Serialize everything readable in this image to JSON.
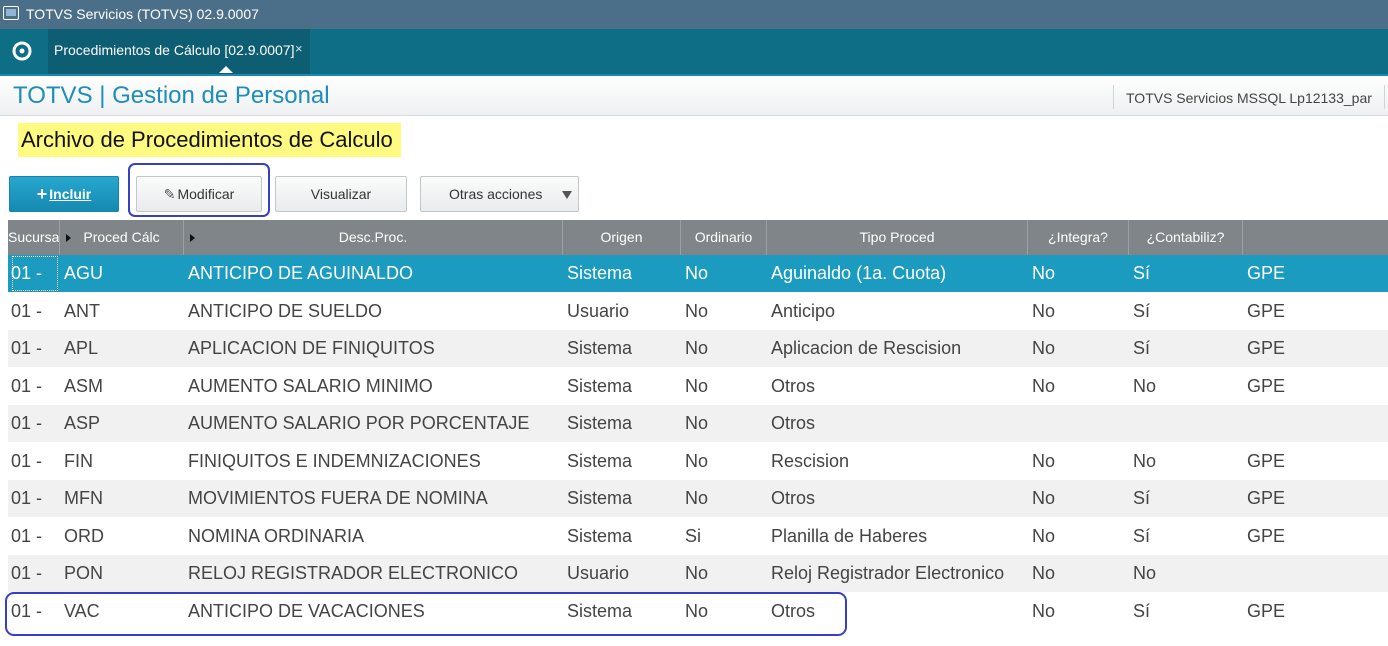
{
  "window": {
    "title": "TOTVS Servicios (TOTVS) 02.9.0007"
  },
  "tabs": [
    {
      "label": "Procedimientos de Cálculo [02.9.0007]",
      "close": "×",
      "active": true
    }
  ],
  "header": {
    "app_title": "TOTVS | Gestion de Personal",
    "environment": "TOTVS Servicios MSSQL Lp12133_par"
  },
  "page": {
    "title": "Archivo de Procedimientos de Calculo"
  },
  "toolbar": {
    "include_label": "Incluir",
    "modify_label": "Modificar",
    "view_label": "Visualizar",
    "more_label": "Otras acciones"
  },
  "grid": {
    "columns": [
      "Sucursa",
      "Proced Cálc",
      "Desc.Proc.",
      "Origen",
      "Ordinario",
      "Tipo Proced",
      "¿Integra?",
      "¿Contabiliz?",
      ""
    ],
    "rows": [
      {
        "branch": "01  -",
        "code": "AGU",
        "desc": "ANTICIPO DE AGUINALDO",
        "origin": "Sistema",
        "ordinary": "No",
        "type": "Aguinaldo (1a. Cuota)",
        "integrates": "No",
        "accounts": "Sí",
        "module": "GPE",
        "selected": true
      },
      {
        "branch": "01  -",
        "code": "ANT",
        "desc": "ANTICIPO DE SUELDO",
        "origin": "Usuario",
        "ordinary": "No",
        "type": "Anticipo",
        "integrates": "No",
        "accounts": "Sí",
        "module": "GPE"
      },
      {
        "branch": "01  -",
        "code": "APL",
        "desc": "APLICACION DE FINIQUITOS",
        "origin": "Sistema",
        "ordinary": "No",
        "type": "Aplicacion de Rescision",
        "integrates": "No",
        "accounts": "Sí",
        "module": "GPE"
      },
      {
        "branch": "01  -",
        "code": "ASM",
        "desc": "AUMENTO SALARIO MINIMO",
        "origin": "Sistema",
        "ordinary": "No",
        "type": "Otros",
        "integrates": "No",
        "accounts": "No",
        "module": "GPE"
      },
      {
        "branch": "01  -",
        "code": "ASP",
        "desc": "AUMENTO SALARIO POR PORCENTAJE",
        "origin": "Sistema",
        "ordinary": "No",
        "type": "Otros",
        "integrates": "",
        "accounts": "",
        "module": ""
      },
      {
        "branch": "01  -",
        "code": "FIN",
        "desc": "FINIQUITOS E INDEMNIZACIONES",
        "origin": "Sistema",
        "ordinary": "No",
        "type": "Rescision",
        "integrates": "No",
        "accounts": "No",
        "module": "GPE"
      },
      {
        "branch": "01  -",
        "code": "MFN",
        "desc": "MOVIMIENTOS FUERA DE NOMINA",
        "origin": "Sistema",
        "ordinary": "No",
        "type": "Otros",
        "integrates": "No",
        "accounts": "Sí",
        "module": "GPE"
      },
      {
        "branch": "01  -",
        "code": "ORD",
        "desc": "NOMINA ORDINARIA",
        "origin": "Sistema",
        "ordinary": "Si",
        "type": "Planilla de Haberes",
        "integrates": "No",
        "accounts": "Sí",
        "module": "GPE"
      },
      {
        "branch": "01  -",
        "code": "PON",
        "desc": "RELOJ REGISTRADOR ELECTRONICO",
        "origin": "Usuario",
        "ordinary": "No",
        "type": "Reloj Registrador Electronico",
        "integrates": "No",
        "accounts": "No",
        "module": ""
      },
      {
        "branch": "01  -",
        "code": "VAC",
        "desc": "ANTICIPO DE VACACIONES",
        "origin": "Sistema",
        "ordinary": "No",
        "type": "Otros",
        "integrates": "No",
        "accounts": "Sí",
        "module": "GPE"
      }
    ]
  },
  "colors": {
    "accent": "#1b9bc0",
    "tab_bar": "#0e6e86",
    "title_highlight": "#fffb80",
    "annotation": "#3740c4"
  }
}
